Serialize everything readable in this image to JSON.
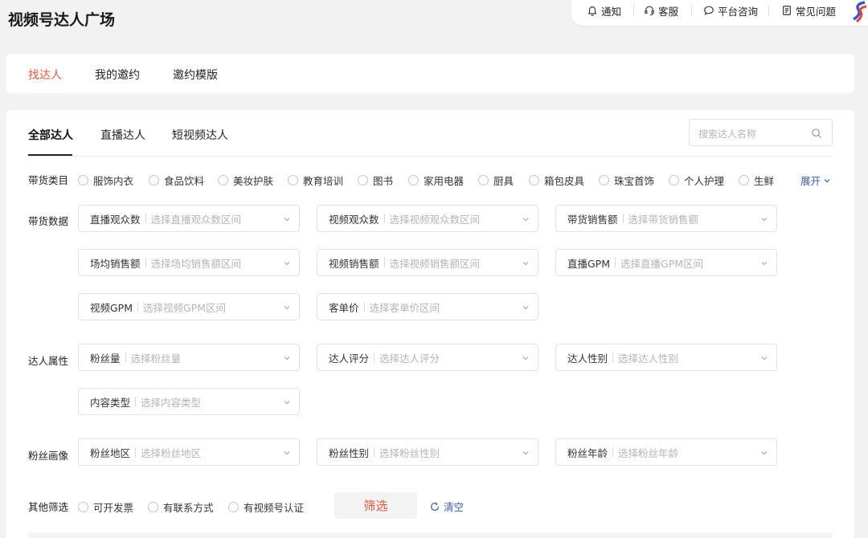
{
  "page": {
    "title": "视频号达人广场"
  },
  "topbar": {
    "items": [
      {
        "label": "通知",
        "icon": "bell-icon"
      },
      {
        "label": "客服",
        "icon": "headset-icon"
      },
      {
        "label": "平台咨询",
        "icon": "chat-bubble-icon"
      },
      {
        "label": "常见问题",
        "icon": "document-icon"
      }
    ]
  },
  "main_tabs": [
    {
      "label": "找达人",
      "active": true
    },
    {
      "label": "我的邀约",
      "active": false
    },
    {
      "label": "邀约模版",
      "active": false
    }
  ],
  "sub_tabs": [
    {
      "label": "全部达人",
      "active": true
    },
    {
      "label": "直播达人",
      "active": false
    },
    {
      "label": "短视频达人",
      "active": false
    }
  ],
  "search": {
    "placeholder": "搜索达人名称"
  },
  "categories": {
    "label": "带货类目",
    "options": [
      "服饰内衣",
      "食品饮料",
      "美妆护肤",
      "教育培训",
      "图书",
      "家用电器",
      "厨具",
      "箱包皮具",
      "珠宝首饰",
      "个人护理",
      "生鲜"
    ],
    "expand_label": "展开"
  },
  "sales_data": {
    "label": "带货数据",
    "selects": [
      {
        "label": "直播观众数",
        "placeholder": "选择直播观众数区间"
      },
      {
        "label": "视频观众数",
        "placeholder": "选择视频观众数区间"
      },
      {
        "label": "带货销售额",
        "placeholder": "选择带货销售额"
      },
      {
        "label": "场均销售额",
        "placeholder": "选择场均销售额区间"
      },
      {
        "label": "视频销售额",
        "placeholder": "选择视频销售额区间"
      },
      {
        "label": "直播GPM",
        "placeholder": "选择直播GPM区间"
      },
      {
        "label": "视频GPM",
        "placeholder": "选择视频GPM区间"
      },
      {
        "label": "客单价",
        "placeholder": "选择客单价区间"
      }
    ]
  },
  "attributes": {
    "label": "达人属性",
    "selects": [
      {
        "label": "粉丝量",
        "placeholder": "选择粉丝量"
      },
      {
        "label": "达人评分",
        "placeholder": "选择达人评分"
      },
      {
        "label": "达人性别",
        "placeholder": "选择达人性别"
      },
      {
        "label": "内容类型",
        "placeholder": "选择内容类型"
      }
    ]
  },
  "fan_profile": {
    "label": "粉丝画像",
    "selects": [
      {
        "label": "粉丝地区",
        "placeholder": "选择粉丝地区"
      },
      {
        "label": "粉丝性别",
        "placeholder": "选择粉丝性别"
      },
      {
        "label": "粉丝年龄",
        "placeholder": "选择粉丝年龄"
      }
    ]
  },
  "other": {
    "label": "其他筛选",
    "options": [
      "可开发票",
      "有联系方式",
      "有视频号认证"
    ]
  },
  "actions": {
    "filter_label": "筛选",
    "clear_label": "清空"
  },
  "colors": {
    "accent": "#f0553a",
    "link": "#3a5fa8"
  }
}
